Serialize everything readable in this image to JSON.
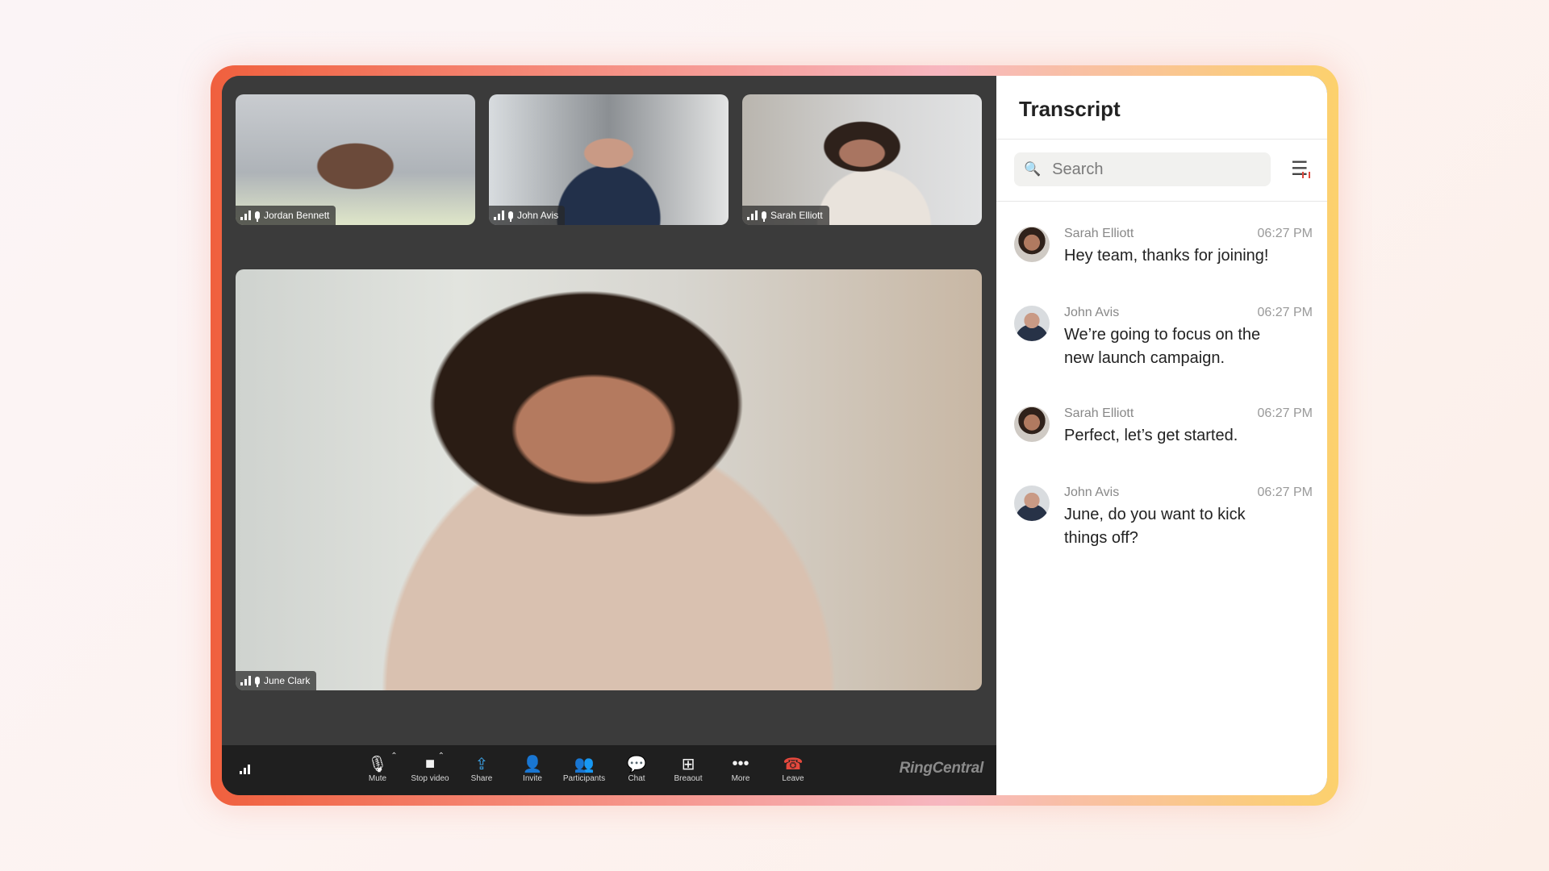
{
  "meeting": {
    "participants": [
      {
        "name": "Jordan Bennett"
      },
      {
        "name": "John Avis"
      },
      {
        "name": "Sarah Elliott"
      }
    ],
    "speaker": {
      "name": "June Clark"
    }
  },
  "toolbar": {
    "buttons": [
      {
        "label": "Mute",
        "icon": "microphone-icon"
      },
      {
        "label": "Stop video",
        "icon": "video-camera-icon"
      },
      {
        "label": "Share",
        "icon": "share-screen-icon"
      },
      {
        "label": "Invite",
        "icon": "add-person-icon"
      },
      {
        "label": "Participants",
        "icon": "participants-icon"
      },
      {
        "label": "Chat",
        "icon": "chat-bubble-icon"
      },
      {
        "label": "Breaout",
        "icon": "grid-icon"
      },
      {
        "label": "More",
        "icon": "more-dots-icon"
      },
      {
        "label": "Leave",
        "icon": "hang-up-icon"
      }
    ],
    "brand": "RingCentral",
    "accent_color": "#3ca2e6",
    "leave_color": "#e5483d"
  },
  "transcript": {
    "title": "Transcript",
    "search_placeholder": "Search",
    "messages": [
      {
        "name": "Sarah Elliott",
        "time": "06:27 PM",
        "text": "Hey team, thanks for joining!"
      },
      {
        "name": "John Avis",
        "time": "06:27 PM",
        "text": "We’re going to focus on the new launch campaign."
      },
      {
        "name": "Sarah Elliott",
        "time": "06:27 PM",
        "text": "Perfect, let’s get started."
      },
      {
        "name": "John Avis",
        "time": "06:27 PM",
        "text": "June, do you want to kick things off?"
      }
    ]
  }
}
